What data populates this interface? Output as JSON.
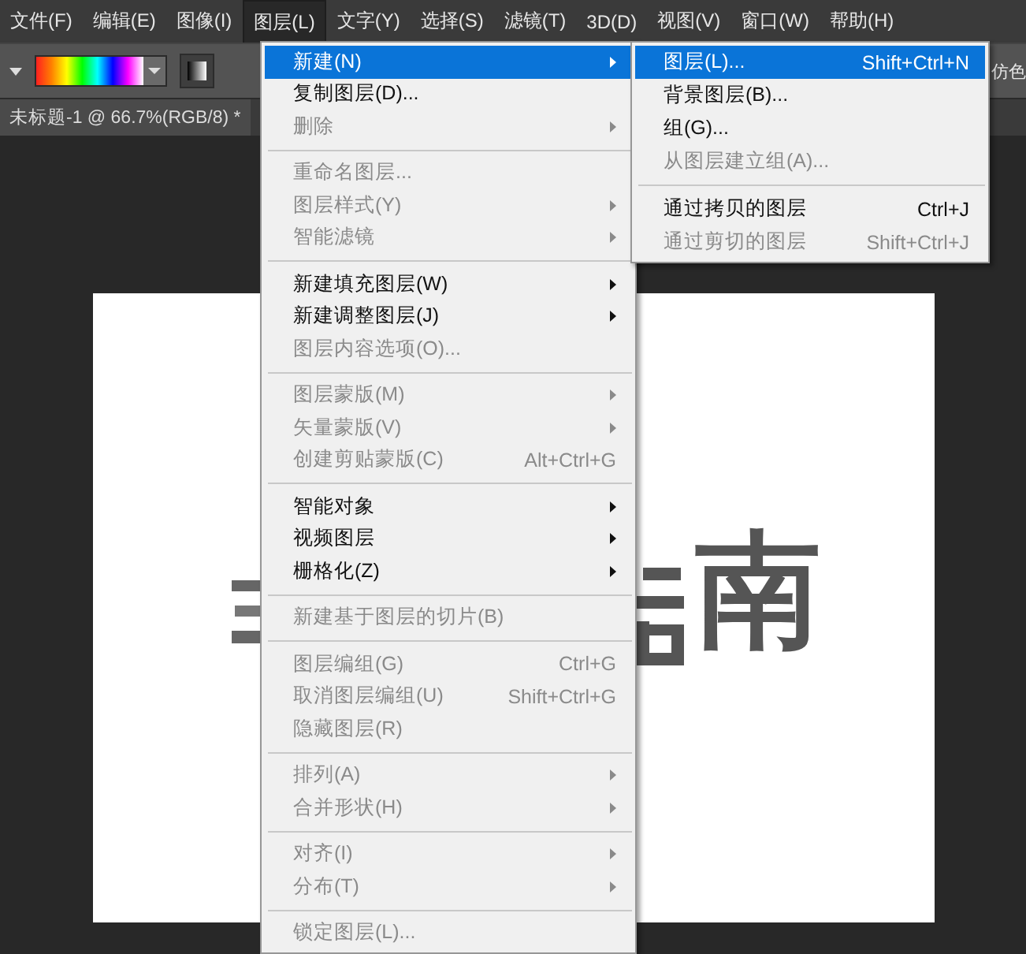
{
  "menu_bar": [
    {
      "label": "文件(F)",
      "selected": false
    },
    {
      "label": "编辑(E)",
      "selected": false
    },
    {
      "label": "图像(I)",
      "selected": false
    },
    {
      "label": "图层(L)",
      "selected": true
    },
    {
      "label": "文字(Y)",
      "selected": false
    },
    {
      "label": "选择(S)",
      "selected": false
    },
    {
      "label": "滤镜(T)",
      "selected": false
    },
    {
      "label": "3D(D)",
      "selected": false
    },
    {
      "label": "视图(V)",
      "selected": false
    },
    {
      "label": "窗口(W)",
      "selected": false
    },
    {
      "label": "帮助(H)",
      "selected": false
    }
  ],
  "options_bar": {
    "right_label": "仿色"
  },
  "document_tab": {
    "title": "未标题-1 @ 66.7%(RGB/8) *"
  },
  "canvas": {
    "text": "南"
  },
  "layer_menu": {
    "sections": [
      [
        {
          "label": "新建(N)",
          "disabled": false,
          "submenu": true,
          "selected": true
        },
        {
          "label": "复制图层(D)...",
          "disabled": false,
          "submenu": false,
          "selected": false
        },
        {
          "label": "删除",
          "disabled": true,
          "submenu": true,
          "selected": false
        }
      ],
      [
        {
          "label": "重命名图层...",
          "disabled": true,
          "submenu": false,
          "selected": false
        },
        {
          "label": "图层样式(Y)",
          "disabled": true,
          "submenu": true,
          "selected": false
        },
        {
          "label": "智能滤镜",
          "disabled": true,
          "submenu": true,
          "selected": false
        }
      ],
      [
        {
          "label": "新建填充图层(W)",
          "disabled": false,
          "submenu": true,
          "selected": false
        },
        {
          "label": "新建调整图层(J)",
          "disabled": false,
          "submenu": true,
          "selected": false
        },
        {
          "label": "图层内容选项(O)...",
          "disabled": true,
          "submenu": false,
          "selected": false
        }
      ],
      [
        {
          "label": "图层蒙版(M)",
          "disabled": true,
          "submenu": true,
          "selected": false
        },
        {
          "label": "矢量蒙版(V)",
          "disabled": true,
          "submenu": true,
          "selected": false
        },
        {
          "label": "创建剪贴蒙版(C)",
          "shortcut": "Alt+Ctrl+G",
          "disabled": true,
          "submenu": false,
          "selected": false
        }
      ],
      [
        {
          "label": "智能对象",
          "disabled": false,
          "submenu": true,
          "selected": false
        },
        {
          "label": "视频图层",
          "disabled": false,
          "submenu": true,
          "selected": false
        },
        {
          "label": "栅格化(Z)",
          "disabled": false,
          "submenu": true,
          "selected": false
        }
      ],
      [
        {
          "label": "新建基于图层的切片(B)",
          "disabled": true,
          "submenu": false,
          "selected": false
        }
      ],
      [
        {
          "label": "图层编组(G)",
          "shortcut": "Ctrl+G",
          "disabled": true,
          "submenu": false,
          "selected": false
        },
        {
          "label": "取消图层编组(U)",
          "shortcut": "Shift+Ctrl+G",
          "disabled": true,
          "submenu": false,
          "selected": false
        },
        {
          "label": "隐藏图层(R)",
          "disabled": true,
          "submenu": false,
          "selected": false
        }
      ],
      [
        {
          "label": "排列(A)",
          "disabled": true,
          "submenu": true,
          "selected": false
        },
        {
          "label": "合并形状(H)",
          "disabled": true,
          "submenu": true,
          "selected": false
        }
      ],
      [
        {
          "label": "对齐(I)",
          "disabled": true,
          "submenu": true,
          "selected": false
        },
        {
          "label": "分布(T)",
          "disabled": true,
          "submenu": true,
          "selected": false
        }
      ],
      [
        {
          "label": "锁定图层(L)...",
          "disabled": true,
          "submenu": false,
          "selected": false
        }
      ]
    ]
  },
  "new_submenu": {
    "sections": [
      [
        {
          "label": "图层(L)...",
          "shortcut": "Shift+Ctrl+N",
          "disabled": false,
          "submenu": false,
          "selected": true
        },
        {
          "label": "背景图层(B)...",
          "disabled": false,
          "submenu": false,
          "selected": false
        },
        {
          "label": "组(G)...",
          "disabled": false,
          "submenu": false,
          "selected": false
        },
        {
          "label": "从图层建立组(A)...",
          "disabled": true,
          "submenu": false,
          "selected": false
        }
      ],
      [
        {
          "label": "通过拷贝的图层",
          "shortcut": "Ctrl+J",
          "disabled": false,
          "submenu": false,
          "selected": false
        },
        {
          "label": "通过剪切的图层",
          "shortcut": "Shift+Ctrl+J",
          "disabled": true,
          "submenu": false,
          "selected": false
        }
      ]
    ]
  }
}
